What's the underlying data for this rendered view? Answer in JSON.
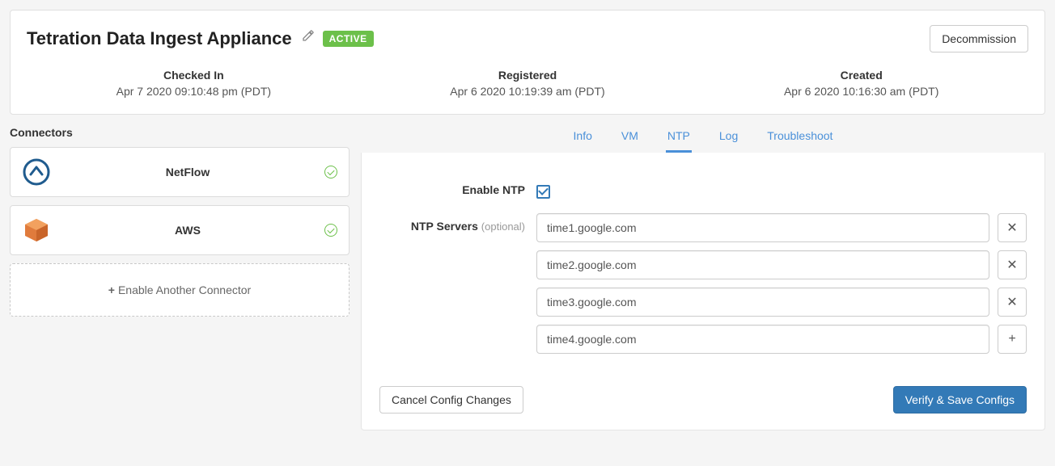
{
  "header": {
    "title": "Tetration Data Ingest Appliance",
    "status_badge": "ACTIVE",
    "decommission_label": "Decommission",
    "meta": [
      {
        "label": "Checked In",
        "value": "Apr 7 2020 09:10:48 pm (PDT)"
      },
      {
        "label": "Registered",
        "value": "Apr 6 2020 10:19:39 am (PDT)"
      },
      {
        "label": "Created",
        "value": "Apr 6 2020 10:16:30 am (PDT)"
      }
    ]
  },
  "connectors": {
    "heading": "Connectors",
    "items": [
      {
        "name": "NetFlow",
        "icon": "netflow"
      },
      {
        "name": "AWS",
        "icon": "aws"
      }
    ],
    "add_label": "Enable Another Connector"
  },
  "tabs": {
    "items": [
      "Info",
      "VM",
      "NTP",
      "Log",
      "Troubleshoot"
    ],
    "active": "NTP"
  },
  "ntp": {
    "enable_label": "Enable NTP",
    "enabled": true,
    "servers_label": "NTP Servers",
    "servers_optional": "(optional)",
    "servers": [
      "time1.google.com",
      "time2.google.com",
      "time3.google.com",
      "time4.google.com"
    ],
    "cancel_label": "Cancel Config Changes",
    "save_label": "Verify & Save Configs"
  }
}
